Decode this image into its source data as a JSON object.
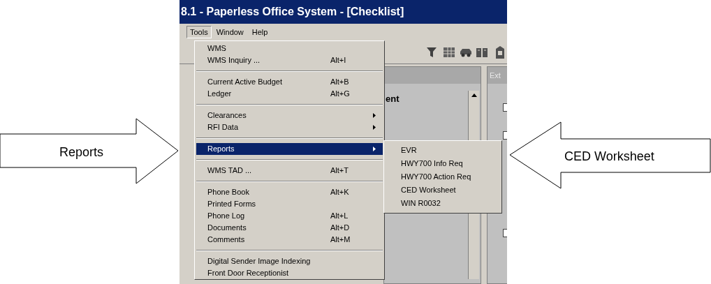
{
  "window": {
    "title": "8.1 - Paperless Office System - [Checklist]"
  },
  "menu_bar": [
    {
      "label": "Tools",
      "selected": true
    },
    {
      "label": "Window",
      "selected": false
    },
    {
      "label": "Help",
      "selected": false
    }
  ],
  "background": {
    "panel_header": "Ext",
    "heading_fragment": "ent",
    "checkboxes": [
      {
        "checked": false
      },
      {
        "checked": false
      },
      {
        "checked": false
      }
    ]
  },
  "tools_menu": [
    {
      "kind": "item",
      "label": "WMS",
      "submenu": false,
      "selected": false
    },
    {
      "kind": "item",
      "label": "WMS Inquiry ...",
      "shortcut": "Alt+I",
      "submenu": false,
      "selected": false
    },
    {
      "kind": "separator"
    },
    {
      "kind": "item",
      "label": "Current Active Budget",
      "shortcut": "Alt+B",
      "submenu": false,
      "selected": false
    },
    {
      "kind": "item",
      "label": "Ledger",
      "shortcut": "Alt+G",
      "submenu": false,
      "selected": false
    },
    {
      "kind": "separator"
    },
    {
      "kind": "item",
      "label": "Clearances",
      "submenu": true,
      "selected": false
    },
    {
      "kind": "item",
      "label": "RFI Data",
      "submenu": true,
      "selected": false
    },
    {
      "kind": "separator"
    },
    {
      "kind": "item",
      "label": "Reports",
      "submenu": true,
      "selected": true
    },
    {
      "kind": "separator"
    },
    {
      "kind": "item",
      "label": "WMS TAD ...",
      "shortcut": "Alt+T",
      "submenu": false,
      "selected": false
    },
    {
      "kind": "separator"
    },
    {
      "kind": "item",
      "label": "Phone Book",
      "shortcut": "Alt+K",
      "submenu": false,
      "selected": false
    },
    {
      "kind": "item",
      "label": "Printed Forms",
      "submenu": false,
      "selected": false
    },
    {
      "kind": "item",
      "label": "Phone Log",
      "shortcut": "Alt+L",
      "submenu": false,
      "selected": false
    },
    {
      "kind": "item",
      "label": "Documents",
      "shortcut": "Alt+D",
      "submenu": false,
      "selected": false
    },
    {
      "kind": "item",
      "label": "Comments",
      "shortcut": "Alt+M",
      "submenu": false,
      "selected": false
    },
    {
      "kind": "separator"
    },
    {
      "kind": "item",
      "label": "Digital Sender Image Indexing",
      "submenu": false,
      "selected": false
    },
    {
      "kind": "item",
      "label": "Front Door Receptionist",
      "submenu": false,
      "selected": false
    }
  ],
  "reports_submenu": [
    "EVR",
    "HWY700 Info Req",
    "HWY700 Action Req",
    "CED Worksheet",
    "WIN R0032"
  ],
  "callouts": [
    {
      "label": "Reports",
      "kind": "rightward"
    },
    {
      "label": "CED Worksheet",
      "kind": "leftward"
    }
  ]
}
